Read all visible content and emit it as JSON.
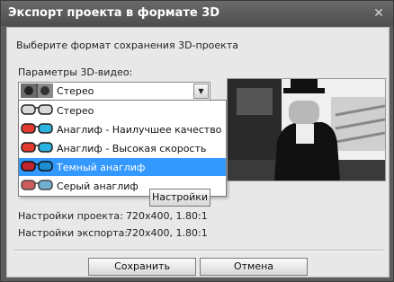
{
  "window": {
    "title": "Экспорт проекта в формате 3D"
  },
  "instruction": "Выберите формат сохранения 3D-проекта",
  "params_label": "Параметры 3D-видео:",
  "combo": {
    "selected": "Стерео"
  },
  "dropdown": {
    "options": [
      {
        "label": "Стерео",
        "lens_left": "#e8e8e8",
        "lens_right": "#e8e8e8"
      },
      {
        "label": "Анаглиф - Наилучшее качество",
        "lens_left": "#e33a2f",
        "lens_right": "#2bb3e0"
      },
      {
        "label": "Анаглиф - Высокая скорость",
        "lens_left": "#e33a2f",
        "lens_right": "#2bb3e0"
      },
      {
        "label": "Темный анаглиф",
        "lens_left": "#c0262f",
        "lens_right": "#1d8fd1"
      },
      {
        "label": "Серый анаглиф",
        "lens_left": "#d05d5d",
        "lens_right": "#6fb0d0"
      }
    ],
    "highlighted_index": 3
  },
  "settings_button": "Настройки",
  "project_settings": {
    "label": "Настройки проекта:",
    "value": "720x400, 1.80:1"
  },
  "export_settings": {
    "label": "Настройки экспорта:",
    "value": "720x400, 1.80:1"
  },
  "buttons": {
    "save": "Сохранить",
    "cancel": "Отмена"
  },
  "colors": {
    "highlight": "#3399ff",
    "titlebar": "#5b5b5b",
    "panel": "#e8e8e8"
  }
}
